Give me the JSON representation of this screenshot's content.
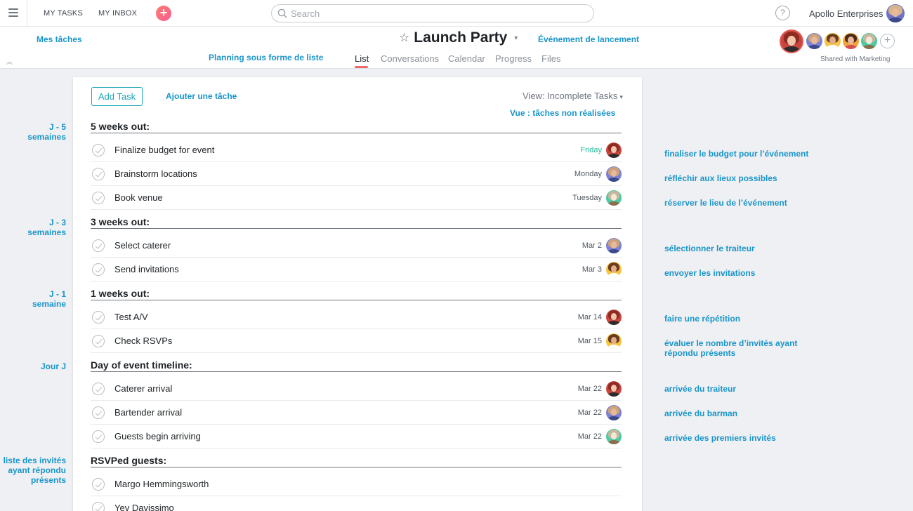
{
  "topbar": {
    "my_tasks": "MY TASKS",
    "my_inbox": "MY INBOX",
    "add_symbol": "+",
    "search_placeholder": "Search",
    "help_symbol": "?",
    "org_name": "Apollo Enterprises"
  },
  "project": {
    "title": "Launch Party",
    "tabs": [
      "List",
      "Conversations",
      "Calendar",
      "Progress",
      "Files"
    ],
    "active_tab": "List",
    "shared_with": "Shared with Marketing",
    "add_member_symbol": "+"
  },
  "list": {
    "add_task_label": "Add Task",
    "view_label": "View: Incomplete Tasks",
    "sections": [
      {
        "title": "5 weeks out:",
        "tasks": [
          {
            "name": "Finalize budget for event",
            "due": "Friday",
            "due_soon": true,
            "assignee": "woman-red-hair"
          },
          {
            "name": "Brainstorm locations",
            "due": "Monday",
            "assignee": "man-purple"
          },
          {
            "name": "Book venue",
            "due": "Tuesday",
            "assignee": "dog-green"
          }
        ]
      },
      {
        "title": "3 weeks out:",
        "tasks": [
          {
            "name": "Select caterer",
            "due": "Mar 2",
            "assignee": "man-purple"
          },
          {
            "name": "Send invitations",
            "due": "Mar 3",
            "assignee": "woman-yellow"
          }
        ]
      },
      {
        "title": "1 weeks out:",
        "tasks": [
          {
            "name": "Test A/V",
            "due": "Mar 14",
            "assignee": "woman-red-hair"
          },
          {
            "name": "Check RSVPs",
            "due": "Mar 15",
            "assignee": "woman-yellow"
          }
        ]
      },
      {
        "title": "Day of event timeline:",
        "tasks": [
          {
            "name": "Caterer arrival",
            "due": "Mar 22",
            "assignee": "woman-red-hair"
          },
          {
            "name": "Bartender arrival",
            "due": "Mar 22",
            "assignee": "man-purple"
          },
          {
            "name": "Guests begin arriving",
            "due": "Mar 22",
            "assignee": "dog-green"
          }
        ]
      },
      {
        "title": "RSVPed guests:",
        "tasks": [
          {
            "name": "Margo Hemmingsworth",
            "due": ""
          },
          {
            "name": "Yev Davissimo",
            "due": ""
          }
        ]
      }
    ]
  },
  "annotations": {
    "mes_taches": "Mes tâches",
    "evenement": "Événement de lancement",
    "planning": "Planning sous forme de liste",
    "ajouter": "Ajouter une tâche",
    "vue": "Vue : tâches non réalisées",
    "j5_line1": "J - 5",
    "j5_line2": "semaines",
    "j3_line1": "J - 3",
    "j3_line2": "semaines",
    "j1_line1": "J - 1",
    "j1_line2": "semaine",
    "jour_j": "Jour J",
    "rsvp_line1": "liste des invités",
    "rsvp_line2": "ayant répondu",
    "rsvp_line3": "présents",
    "t1": "finaliser le budget pour l’événement",
    "t2": "réfléchir aux lieux possibles",
    "t3": "réserver le lieu de l’événement",
    "t4": "sélectionner le traiteur",
    "t5": "envoyer les invitations",
    "t6": "faire une répétition",
    "t7_line1": "évaluer le nombre d’invités ayant",
    "t7_line2": "répondu présents",
    "t8": "arrivée du traiteur",
    "t9": "arrivée du barman",
    "t10": "arrivée des premiers invités"
  },
  "colors": {
    "accent_teal": "#1aa6b7",
    "annotation_blue": "#1a95c9",
    "due_soon_green": "#25b99a",
    "tab_underline": "#f06a6a"
  }
}
